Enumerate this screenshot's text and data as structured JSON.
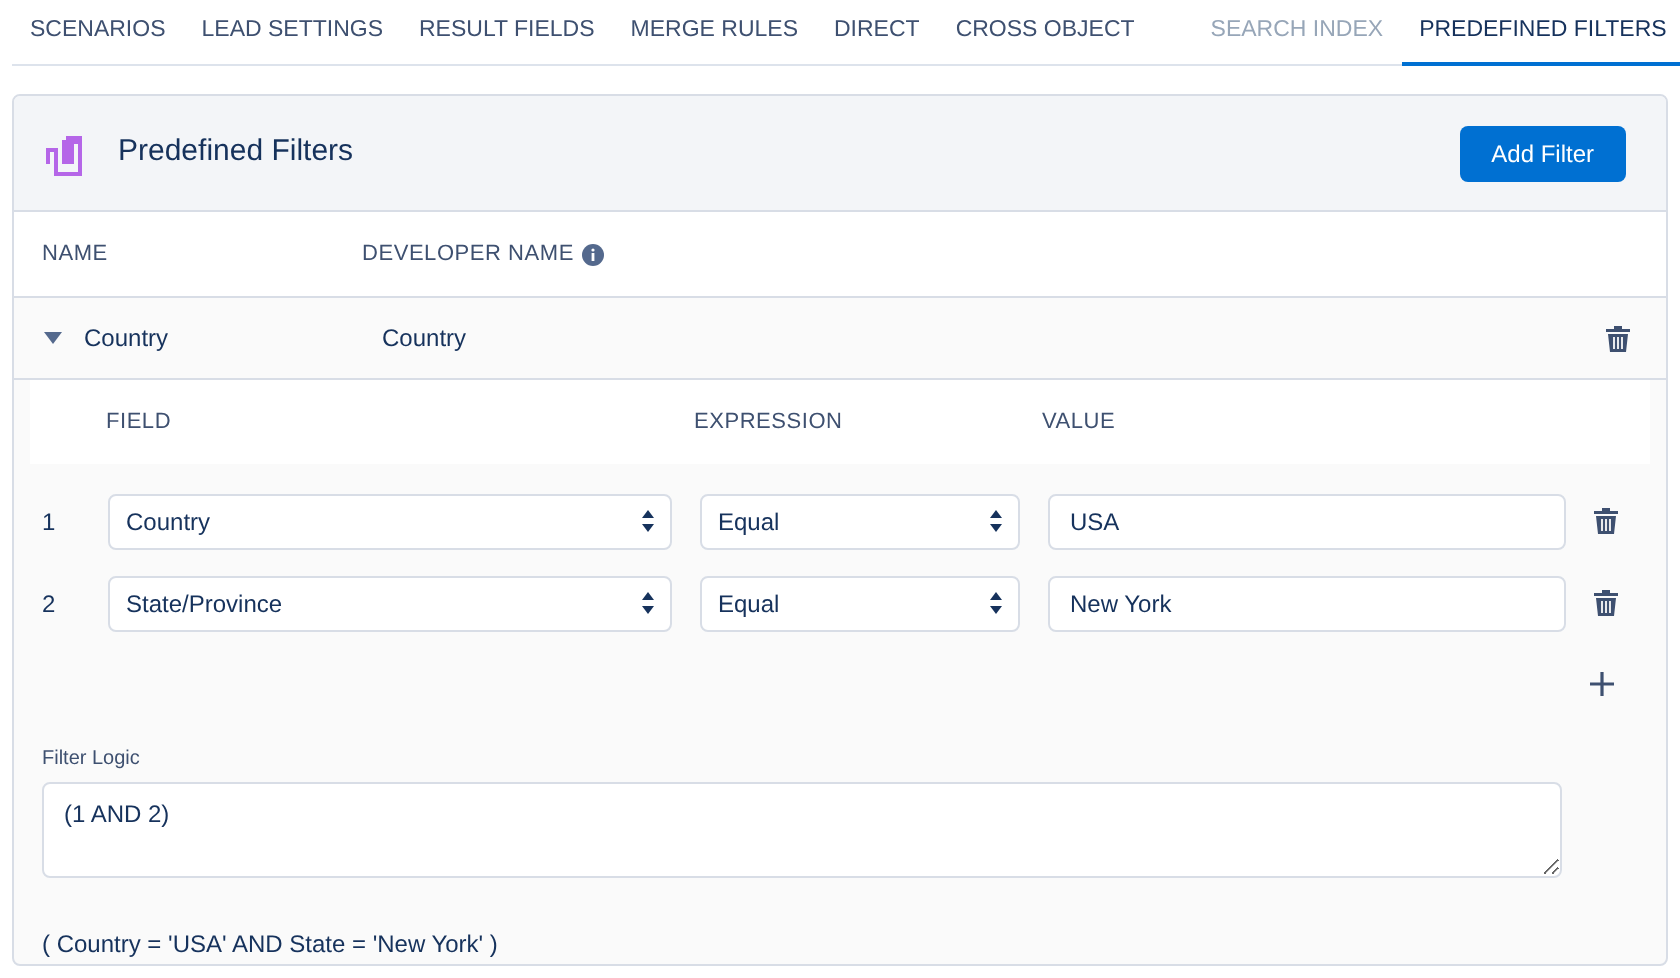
{
  "tabs": [
    {
      "label": "SCENARIOS",
      "selected": false,
      "disabled": false
    },
    {
      "label": "LEAD SETTINGS",
      "selected": false,
      "disabled": false
    },
    {
      "label": "RESULT FIELDS",
      "selected": false,
      "disabled": false
    },
    {
      "label": "MERGE RULES",
      "selected": false,
      "disabled": false
    },
    {
      "label": "DIRECT",
      "selected": false,
      "disabled": false
    },
    {
      "label": "CROSS OBJECT",
      "selected": false,
      "disabled": false
    },
    {
      "label": "SEARCH INDEX",
      "selected": false,
      "disabled": true
    },
    {
      "label": "PREDEFINED FILTERS",
      "selected": true,
      "disabled": false
    }
  ],
  "card": {
    "title": "Predefined Filters",
    "add_button": "Add Filter"
  },
  "table": {
    "columns": [
      "NAME",
      "DEVELOPER NAME"
    ],
    "rows": [
      {
        "name": "Country",
        "developer_name": "Country",
        "expanded": true,
        "conditions_columns": [
          "FIELD",
          "EXPRESSION",
          "VALUE"
        ],
        "conditions": [
          {
            "number": "1",
            "field": "Country",
            "expression": "Equal",
            "value": "USA"
          },
          {
            "number": "2",
            "field": "State/Province",
            "expression": "Equal",
            "value": "New York"
          }
        ],
        "filter_logic_label": "Filter Logic",
        "filter_logic": "(1 AND 2)",
        "summary": "( Country = 'USA' AND State = 'New York' )"
      }
    ]
  }
}
